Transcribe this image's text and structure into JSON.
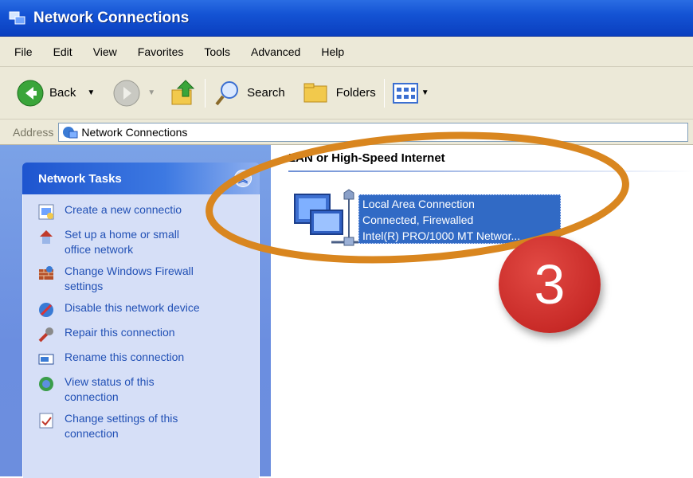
{
  "window": {
    "title": "Network Connections"
  },
  "menu": [
    "File",
    "Edit",
    "View",
    "Favorites",
    "Tools",
    "Advanced",
    "Help"
  ],
  "toolbar": {
    "back_label": "Back",
    "search_label": "Search",
    "folders_label": "Folders"
  },
  "address": {
    "label": "Address",
    "value": "Network Connections"
  },
  "sidebar": {
    "header": "Network Tasks",
    "tasks": [
      {
        "label": "Create a new connectio",
        "icon": "new-connection-icon"
      },
      {
        "label": "Set up a home or small\noffice network",
        "icon": "home-network-icon"
      },
      {
        "label": "Change Windows Firewall\nsettings",
        "icon": "firewall-icon"
      },
      {
        "label": "Disable this network device",
        "icon": "disable-device-icon"
      },
      {
        "label": "Repair this connection",
        "icon": "repair-icon"
      },
      {
        "label": "Rename this connection",
        "icon": "rename-icon"
      },
      {
        "label": "View status of this\nconnection",
        "icon": "status-icon"
      },
      {
        "label": "Change settings of this\nconnection",
        "icon": "settings-icon"
      }
    ]
  },
  "main": {
    "group_header": "LAN or High-Speed Internet",
    "connection": {
      "name": "Local Area Connection",
      "status": "Connected, Firewalled",
      "device": "Intel(R) PRO/1000 MT Networ..."
    }
  },
  "annotation": {
    "step": "3",
    "ring_color": "#d9861f",
    "badge_color": "#d03430"
  },
  "colors": {
    "titlebar": "#1453d4",
    "selection": "#316ac5",
    "task_link": "#2150b5"
  }
}
